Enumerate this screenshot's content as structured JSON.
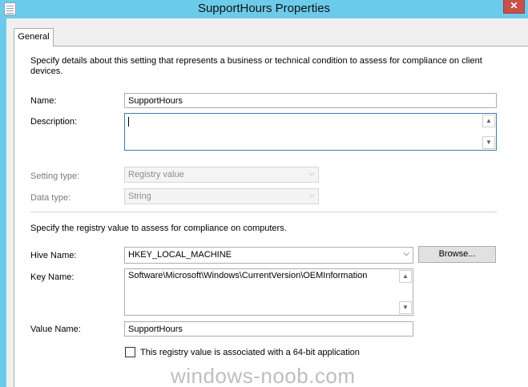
{
  "window": {
    "title": "SupportHours Properties",
    "close_glyph": "✕"
  },
  "tabs": [
    {
      "label": "General"
    }
  ],
  "general": {
    "intro": "Specify details about this setting that represents a business or technical condition to assess for compliance on client",
    "intro_line2": "devices.",
    "name_label": "Name:",
    "name_value": "SupportHours",
    "description_label": "Description:",
    "description_value": "",
    "setting_type_label": "Setting type:",
    "setting_type_value": "Registry value",
    "data_type_label": "Data type:",
    "data_type_value": "String"
  },
  "registry": {
    "intro": "Specify the registry value to assess for compliance on computers.",
    "hive_label": "Hive Name:",
    "hive_value": "HKEY_LOCAL_MACHINE",
    "browse_label": "Browse...",
    "key_label": "Key Name:",
    "key_value": "Software\\Microsoft\\Windows\\CurrentVersion\\OEMInformation",
    "value_name_label": "Value Name:",
    "value_name_value": "SupportHours",
    "checkbox_label": "This registry value is associated with a 64-bit application",
    "checkbox_checked": false
  },
  "watermark": "windows-noob.com",
  "glyphs": {
    "up": "▲",
    "down": "▼",
    "combo_arrow": "⌵"
  }
}
